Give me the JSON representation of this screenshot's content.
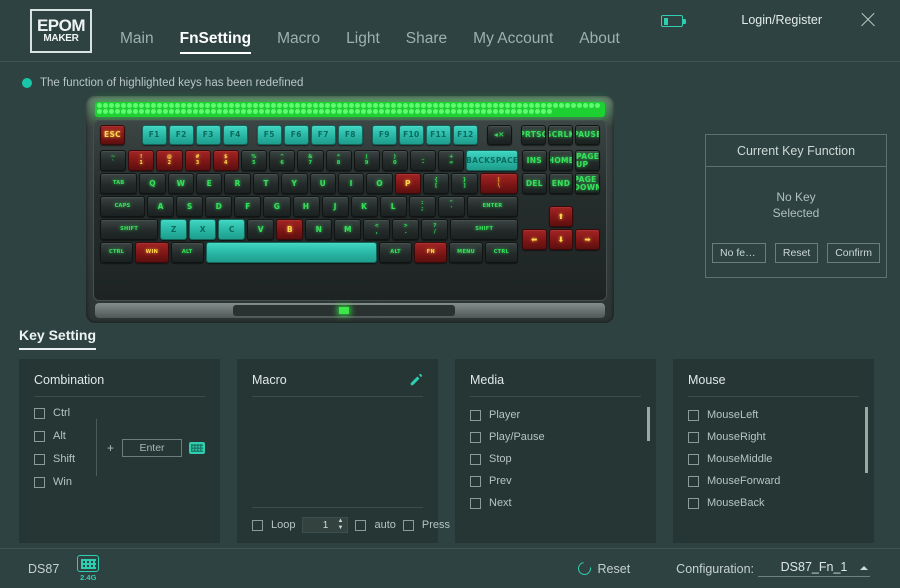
{
  "app": {
    "logo_top": "EPOM",
    "logo_bottom": "MAKER",
    "login_label": "Login/Register",
    "close_icon": "close-icon",
    "battery_icon": "battery-icon"
  },
  "nav": {
    "items": [
      {
        "label": "Main",
        "active": false
      },
      {
        "label": "FnSetting",
        "active": true
      },
      {
        "label": "Macro",
        "active": false
      },
      {
        "label": "Light",
        "active": false
      },
      {
        "label": "Share",
        "active": false
      },
      {
        "label": "My Account",
        "active": false
      },
      {
        "label": "About",
        "active": false
      }
    ]
  },
  "notice": {
    "text": "The function of highlighted keys has been redefined"
  },
  "keyboard": {
    "fn_row": [
      {
        "label": "ESC",
        "color": "red"
      },
      {
        "label": "F1",
        "color": "cyan"
      },
      {
        "label": "F2",
        "color": "cyan"
      },
      {
        "label": "F3",
        "color": "cyan"
      },
      {
        "label": "F4",
        "color": "cyan"
      },
      {
        "label": "F5",
        "color": "cyan"
      },
      {
        "label": "F6",
        "color": "cyan"
      },
      {
        "label": "F7",
        "color": "cyan"
      },
      {
        "label": "F8",
        "color": "cyan"
      },
      {
        "label": "F9",
        "color": "cyan"
      },
      {
        "label": "F10",
        "color": "cyan"
      },
      {
        "label": "F11",
        "color": "cyan"
      },
      {
        "label": "F12",
        "color": "cyan"
      },
      {
        "label": "◂✕",
        "color": "normal"
      },
      {
        "label": "PRTSC",
        "color": "normal"
      },
      {
        "label": "SCRLK",
        "color": "normal"
      },
      {
        "label": "PAUSE",
        "color": "normal"
      }
    ],
    "row1": [
      {
        "top": "~",
        "bottom": "`",
        "color": "normal"
      },
      {
        "top": "!",
        "bottom": "1",
        "color": "red"
      },
      {
        "top": "@",
        "bottom": "2",
        "color": "red"
      },
      {
        "top": "#",
        "bottom": "3",
        "color": "red"
      },
      {
        "top": "$",
        "bottom": "4",
        "color": "red"
      },
      {
        "top": "%",
        "bottom": "5",
        "color": "normal"
      },
      {
        "top": "^",
        "bottom": "6",
        "color": "normal"
      },
      {
        "top": "&",
        "bottom": "7",
        "color": "normal"
      },
      {
        "top": "*",
        "bottom": "8",
        "color": "normal"
      },
      {
        "top": "(",
        "bottom": "9",
        "color": "normal"
      },
      {
        "top": ")",
        "bottom": "0",
        "color": "normal"
      },
      {
        "top": "_",
        "bottom": "-",
        "color": "normal"
      },
      {
        "top": "+",
        "bottom": "=",
        "color": "normal"
      },
      {
        "top": "",
        "bottom": "BACKSPACE",
        "color": "cyan"
      }
    ],
    "row2": [
      {
        "top": "",
        "bottom": "TAB",
        "color": "normal"
      },
      {
        "top": "",
        "bottom": "Q",
        "color": "normal"
      },
      {
        "top": "",
        "bottom": "W",
        "color": "normal"
      },
      {
        "top": "",
        "bottom": "E",
        "color": "normal"
      },
      {
        "top": "",
        "bottom": "R",
        "color": "normal"
      },
      {
        "top": "",
        "bottom": "T",
        "color": "normal"
      },
      {
        "top": "",
        "bottom": "Y",
        "color": "normal"
      },
      {
        "top": "",
        "bottom": "U",
        "color": "normal"
      },
      {
        "top": "",
        "bottom": "I",
        "color": "normal"
      },
      {
        "top": "",
        "bottom": "O",
        "color": "normal"
      },
      {
        "top": "",
        "bottom": "P",
        "color": "red"
      },
      {
        "top": "{",
        "bottom": "[",
        "color": "normal"
      },
      {
        "top": "}",
        "bottom": "]",
        "color": "normal"
      },
      {
        "top": "|",
        "bottom": "\\",
        "color": "red"
      }
    ],
    "row3": [
      {
        "top": "",
        "bottom": "CAPS",
        "color": "normal"
      },
      {
        "top": "",
        "bottom": "A",
        "color": "normal"
      },
      {
        "top": "",
        "bottom": "S",
        "color": "normal"
      },
      {
        "top": "",
        "bottom": "D",
        "color": "normal"
      },
      {
        "top": "",
        "bottom": "F",
        "color": "normal"
      },
      {
        "top": "",
        "bottom": "G",
        "color": "normal"
      },
      {
        "top": "",
        "bottom": "H",
        "color": "normal"
      },
      {
        "top": "",
        "bottom": "J",
        "color": "normal"
      },
      {
        "top": "",
        "bottom": "K",
        "color": "normal"
      },
      {
        "top": "",
        "bottom": "L",
        "color": "normal"
      },
      {
        "top": ":",
        "bottom": ";",
        "color": "normal"
      },
      {
        "top": "\"",
        "bottom": "'",
        "color": "normal"
      },
      {
        "top": "",
        "bottom": "ENTER",
        "color": "normal"
      }
    ],
    "row4": [
      {
        "top": "",
        "bottom": "SHIFT",
        "color": "normal"
      },
      {
        "top": "",
        "bottom": "Z",
        "color": "cyan"
      },
      {
        "top": "",
        "bottom": "X",
        "color": "cyan"
      },
      {
        "top": "",
        "bottom": "C",
        "color": "cyan"
      },
      {
        "top": "",
        "bottom": "V",
        "color": "normal"
      },
      {
        "top": "",
        "bottom": "B",
        "color": "red"
      },
      {
        "top": "",
        "bottom": "N",
        "color": "normal"
      },
      {
        "top": "",
        "bottom": "M",
        "color": "normal"
      },
      {
        "top": "<",
        "bottom": ",",
        "color": "normal"
      },
      {
        "top": ">",
        "bottom": ".",
        "color": "normal"
      },
      {
        "top": "?",
        "bottom": "/",
        "color": "normal"
      },
      {
        "top": "",
        "bottom": "SHIFT",
        "color": "normal"
      }
    ],
    "row5": [
      {
        "top": "",
        "bottom": "CTRL",
        "color": "normal"
      },
      {
        "top": "",
        "bottom": "WIN",
        "color": "red"
      },
      {
        "top": "",
        "bottom": "ALT",
        "color": "normal"
      },
      {
        "top": "",
        "bottom": "",
        "color": "cyan"
      },
      {
        "top": "",
        "bottom": "ALT",
        "color": "normal"
      },
      {
        "top": "",
        "bottom": "FN",
        "color": "red"
      },
      {
        "top": "",
        "bottom": "MENU",
        "color": "normal"
      },
      {
        "top": "",
        "bottom": "CTRL",
        "color": "normal"
      }
    ],
    "nav_row1": [
      {
        "label": "INS",
        "color": "normal"
      },
      {
        "label": "HOME",
        "color": "normal"
      },
      {
        "label": "PAGE UP",
        "color": "normal"
      }
    ],
    "nav_row2": [
      {
        "label": "DEL",
        "color": "normal"
      },
      {
        "label": "END",
        "color": "normal"
      },
      {
        "label": "PAGE DOWN",
        "color": "normal"
      }
    ],
    "arrow_up": {
      "label": "⬆",
      "color": "red"
    },
    "arrow_bottom": [
      {
        "label": "⬅",
        "color": "red"
      },
      {
        "label": "⬇",
        "color": "red"
      },
      {
        "label": "➡",
        "color": "red"
      }
    ]
  },
  "current_key_function": {
    "title": "Current Key Function",
    "status_line1": "No Key",
    "status_line2": "Selected",
    "buttons": [
      {
        "label": "No featu..."
      },
      {
        "label": "Reset"
      },
      {
        "label": "Confirm"
      }
    ]
  },
  "key_setting": {
    "section_title": "Key Setting",
    "combination": {
      "title": "Combination",
      "modifiers": [
        "Ctrl",
        "Alt",
        "Shift",
        "Win"
      ],
      "plus": "+",
      "key_value": "Enter",
      "keyboard_icon": "keyboard-icon"
    },
    "macro": {
      "title": "Macro",
      "edit_icon": "pencil-icon",
      "loop_label": "Loop",
      "loop_value": "1",
      "auto_label": "auto",
      "press_label": "Press"
    },
    "media": {
      "title": "Media",
      "items": [
        "Player",
        "Play/Pause",
        "Stop",
        "Prev",
        "Next"
      ]
    },
    "mouse": {
      "title": "Mouse",
      "items": [
        "MouseLeft",
        "MouseRight",
        "MouseMiddle",
        "MouseForward",
        "MouseBack"
      ]
    }
  },
  "footer": {
    "device_name": "DS87",
    "device_icon": "keyboard-icon",
    "device_mode": "2.4G",
    "reset_label": "Reset",
    "reset_icon": "refresh-icon",
    "configuration_label": "Configuration:",
    "configuration_value": "DS87_Fn_1",
    "caret_icon": "caret-up-icon"
  },
  "colors": {
    "background": "#2e4341",
    "panel": "#253634",
    "accent_cyan": "#2ecfb0",
    "key_red": "#8f1c1c",
    "key_cyan": "#2ec0ab",
    "rgb_green": "#1ed132"
  }
}
